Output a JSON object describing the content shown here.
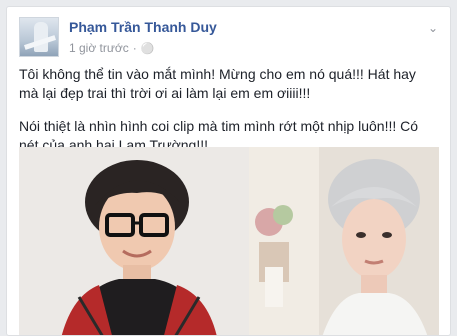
{
  "post": {
    "author": "Phạm Trần Thanh Duy",
    "timestamp": "1 giờ trước",
    "paragraphs": [
      "Tôi không thể tin vào mắt mình! Mừng cho em nó quá!!! Hát hay mà lại đẹp trai thì trời ơi ai làm lại em em ơiiii!!!",
      "Nói thiệt là nhìn hình coi clip mà tim mình rớt một nhịp luôn!!! Có nét của anh hai Lam Trường!!!"
    ],
    "icons": {
      "privacy": "globe-icon",
      "menu": "chevron-down-icon"
    }
  }
}
